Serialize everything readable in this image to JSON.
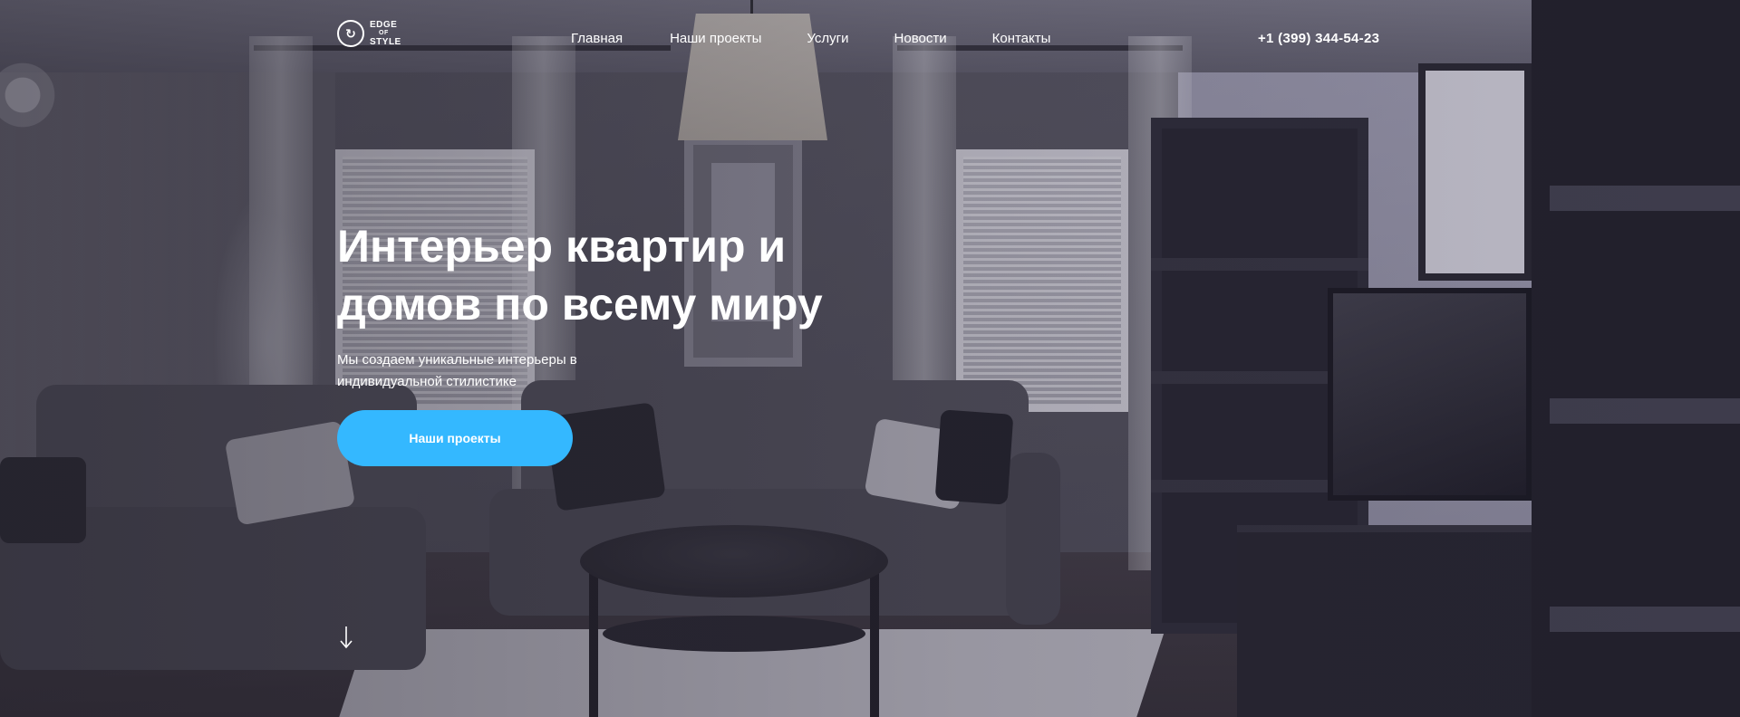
{
  "header": {
    "logo": {
      "mark": "↻",
      "line1": "EDGE",
      "line2": "OF",
      "line3": "STYLE"
    },
    "nav": [
      {
        "label": "Главная"
      },
      {
        "label": "Наши проекты"
      },
      {
        "label": "Услуги"
      },
      {
        "label": "Новости"
      },
      {
        "label": "Контакты"
      }
    ],
    "phone": "+1 (399) 344-54-23"
  },
  "hero": {
    "headline": "Интерьер квартир и домов по всему миру",
    "subline": "Мы создаем уникальные интерьеры в индивидуальной стилистике",
    "cta_label": "Наши проекты",
    "scroll_icon": "arrow-down-icon"
  },
  "colors": {
    "accent": "#34b8ff",
    "text": "#ffffff",
    "overlay": "#2d2a3a"
  }
}
